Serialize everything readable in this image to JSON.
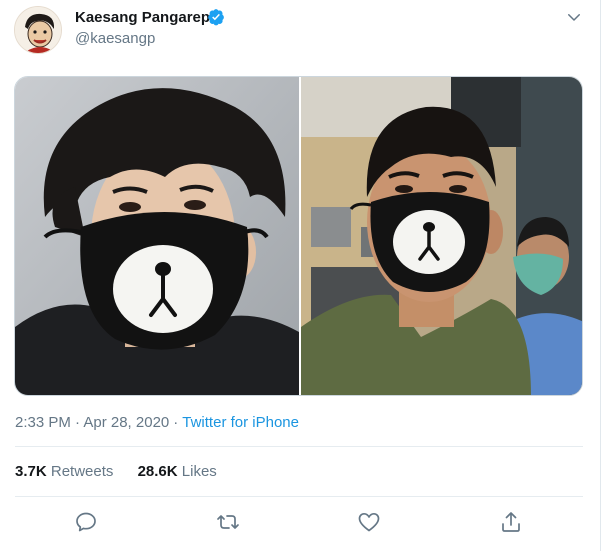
{
  "tweet": {
    "author": {
      "display_name": "Kaesang Pangarep",
      "handle": "@kaesangp",
      "verified": true,
      "avatar_icon": "caricature-avatar"
    },
    "timestamp": "2:33 PM · Apr 28, 2020",
    "separator": "·",
    "source": "Twitter for iPhone",
    "stats": {
      "retweets_count": "3.7K",
      "retweets_label": "Retweets",
      "likes_count": "28.6K",
      "likes_label": "Likes"
    },
    "media": [
      {
        "description_icon": "photo-man-bear-mask-left"
      },
      {
        "description_icon": "photo-man-bear-mask-right"
      }
    ]
  },
  "icons": {
    "verified": "verified-badge-icon",
    "caret": "chevron-down-icon",
    "reply": "reply-icon",
    "retweet": "retweet-icon",
    "like": "heart-icon",
    "share": "share-icon"
  },
  "colors": {
    "text_primary": "#14171a",
    "text_secondary": "#657786",
    "link": "#1b95e0",
    "verified": "#1da1f2",
    "border": "#e6ecf0"
  }
}
